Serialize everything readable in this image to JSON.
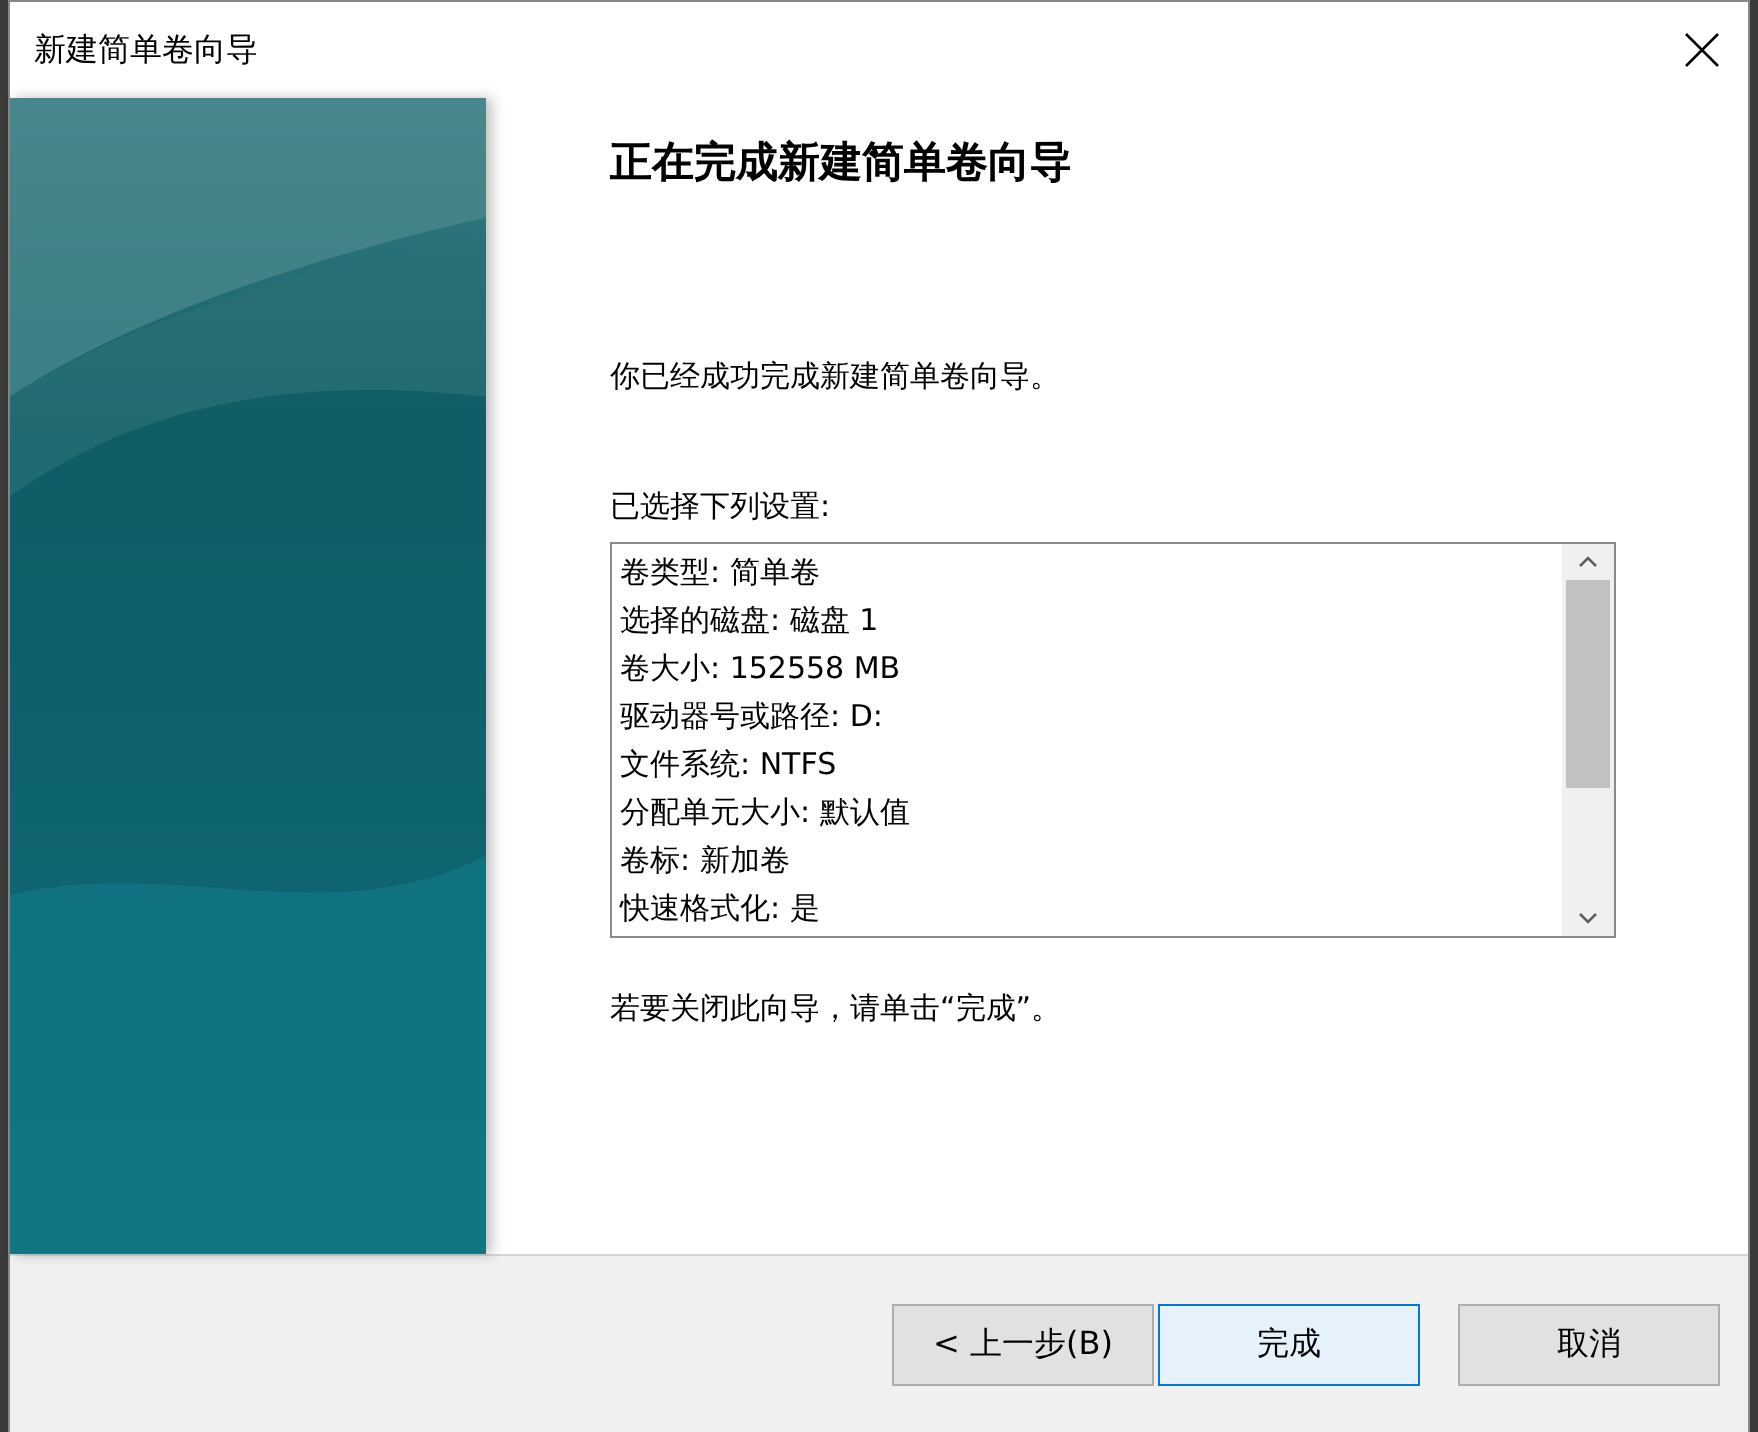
{
  "window": {
    "title": "新建简单卷向导"
  },
  "heading": "正在完成新建简单卷向导",
  "intro": "你已经成功完成新建简单卷向导。",
  "settings_label": "已选择下列设置:",
  "settings": [
    "卷类型: 简单卷",
    "选择的磁盘: 磁盘 1",
    "卷大小: 152558 MB",
    "驱动器号或路径: D:",
    "文件系统: NTFS",
    "分配单元大小: 默认值",
    "卷标: 新加卷",
    "快速格式化: 是"
  ],
  "closing": "若要关闭此向导，请单击“完成”。",
  "buttons": [
    {
      "label": "< 上一步(B)",
      "focused": false
    },
    {
      "label": "完成",
      "focused": true
    },
    {
      "label": "取消",
      "focused": false
    }
  ]
}
